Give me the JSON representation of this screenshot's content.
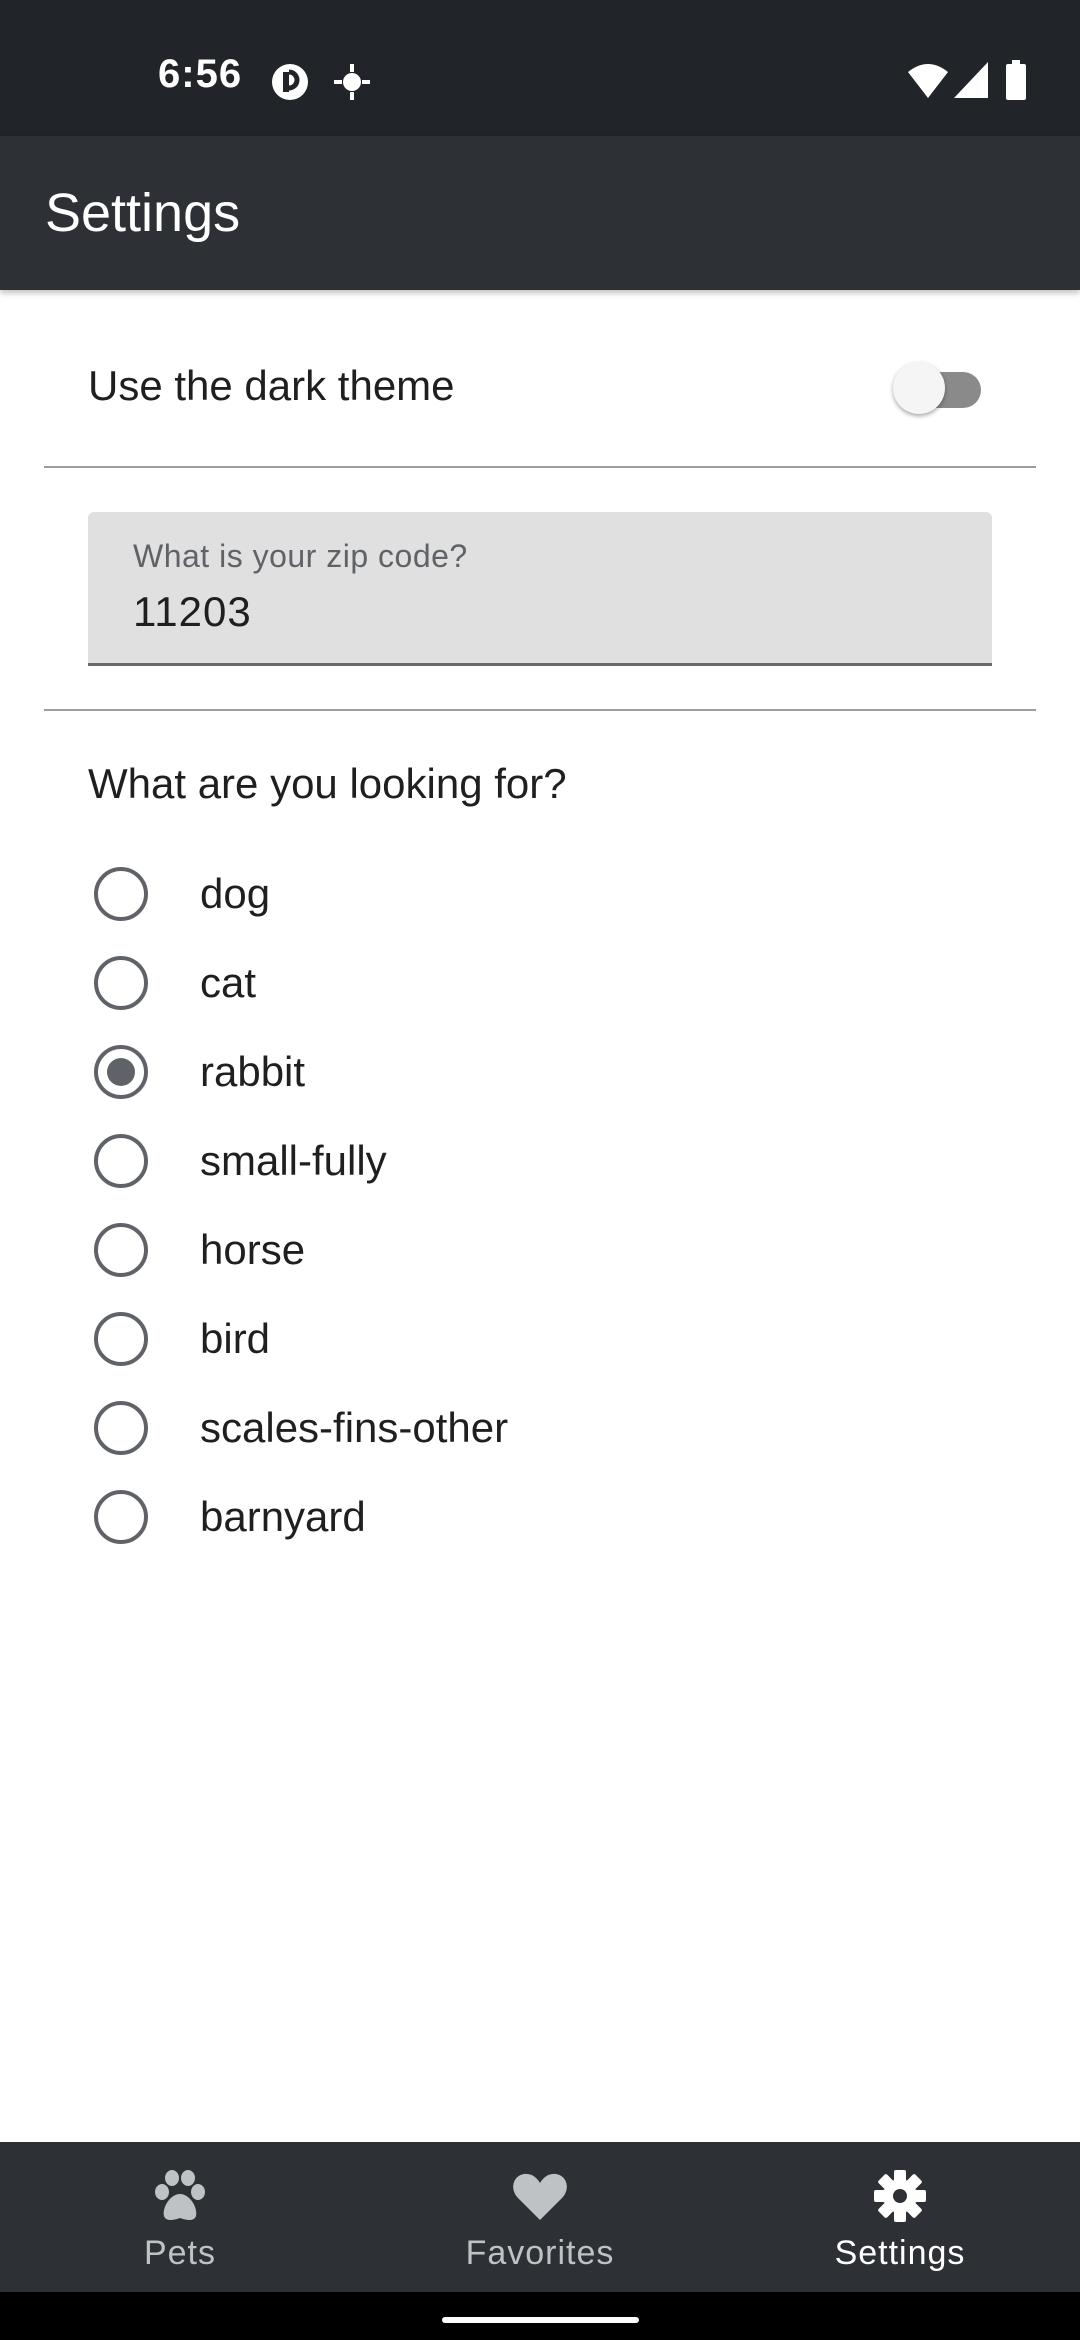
{
  "status_bar": {
    "time": "6:56",
    "icons": [
      "pocket-casts-icon",
      "location-crosshair-icon",
      "wifi-icon",
      "cell-signal-icon",
      "battery-icon"
    ]
  },
  "app_bar": {
    "title": "Settings"
  },
  "settings": {
    "dark_theme_label": "Use the dark theme",
    "dark_theme_enabled": false,
    "zip_label": "What is your zip code?",
    "zip_value": "11203",
    "question": "What are you looking for?",
    "options": [
      {
        "label": "dog",
        "selected": false
      },
      {
        "label": "cat",
        "selected": false
      },
      {
        "label": "rabbit",
        "selected": true
      },
      {
        "label": "small-fully",
        "selected": false
      },
      {
        "label": "horse",
        "selected": false
      },
      {
        "label": "bird",
        "selected": false
      },
      {
        "label": "scales-fins-other",
        "selected": false
      },
      {
        "label": "barnyard",
        "selected": false
      }
    ]
  },
  "bottom_nav": {
    "items": [
      {
        "label": "Pets",
        "icon": "paw-icon",
        "active": false
      },
      {
        "label": "Favorites",
        "icon": "heart-icon",
        "active": false
      },
      {
        "label": "Settings",
        "icon": "gear-icon",
        "active": true
      }
    ]
  },
  "colors": {
    "status_bar": "#212428",
    "app_bar": "#2d3135",
    "radio": "#5f6368",
    "field_bg": "#e0e0e0"
  }
}
